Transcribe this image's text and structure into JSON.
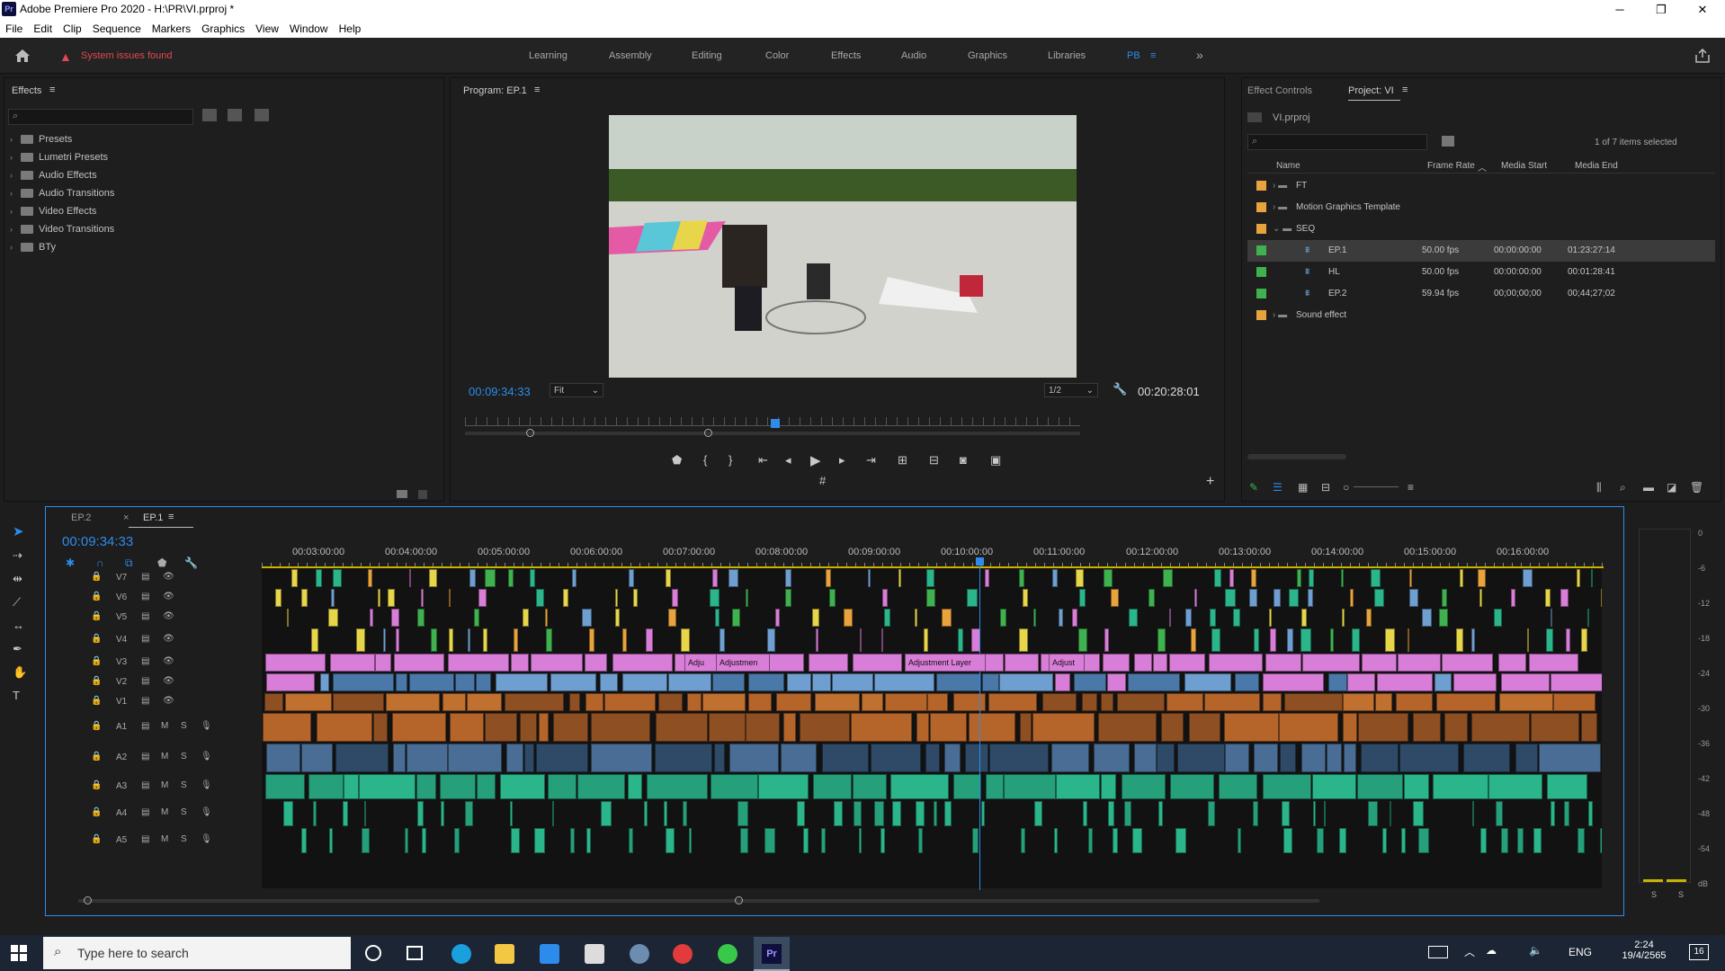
{
  "window": {
    "title": "Adobe Premiere Pro 2020 - H:\\PR\\VI.prproj *",
    "logo": "Pr",
    "minimize": "─",
    "maximize": "❐",
    "close": "✕"
  },
  "menu": [
    "File",
    "Edit",
    "Clip",
    "Sequence",
    "Markers",
    "Graphics",
    "View",
    "Window",
    "Help"
  ],
  "workspace": {
    "warning": "System issues found",
    "tabs": [
      "Learning",
      "Assembly",
      "Editing",
      "Color",
      "Effects",
      "Audio",
      "Graphics",
      "Libraries",
      "PB"
    ],
    "active": "PB",
    "more": "»"
  },
  "effects_panel": {
    "title": "Effects",
    "menu": "≡",
    "items": [
      "Presets",
      "Lumetri Presets",
      "Audio Effects",
      "Audio Transitions",
      "Video Effects",
      "Video Transitions",
      "BTy"
    ]
  },
  "program_monitor": {
    "title": "Program: EP.1",
    "timecode": "00:09:34:33",
    "fit": "Fit",
    "resolution": "1/2",
    "duration": "00:20:28:01",
    "add": "+"
  },
  "project_panel": {
    "tab_effect_controls": "Effect Controls",
    "tab_project": "Project: VI",
    "file": "VI.prproj",
    "count": "1 of 7 items selected",
    "columns": [
      "Name",
      "Frame Rate",
      "Media Start",
      "Media End"
    ],
    "rows": [
      {
        "name": "FT",
        "fps": "",
        "start": "",
        "end": "",
        "color": "#e8a33c",
        "type": "folder"
      },
      {
        "name": "Motion Graphics Template",
        "fps": "",
        "start": "",
        "end": "",
        "color": "#e8a33c",
        "type": "folder"
      },
      {
        "name": "SEQ",
        "fps": "",
        "start": "",
        "end": "",
        "color": "#e8a33c",
        "type": "folder-open"
      },
      {
        "name": "EP.1",
        "fps": "50.00 fps",
        "start": "00:00:00:00",
        "end": "01:23:27:14",
        "color": "#3fb24f",
        "type": "seq",
        "selected": true
      },
      {
        "name": "HL",
        "fps": "50.00 fps",
        "start": "00:00:00:00",
        "end": "00:01:28:41",
        "color": "#3fb24f",
        "type": "seq"
      },
      {
        "name": "EP.2",
        "fps": "59.94 fps",
        "start": "00;00;00;00",
        "end": "00;44;27;02",
        "color": "#3fb24f",
        "type": "seq"
      },
      {
        "name": "Sound effect",
        "fps": "",
        "start": "",
        "end": "",
        "color": "#e8a33c",
        "type": "folder"
      }
    ]
  },
  "timeline": {
    "tabs": [
      "EP.2",
      "EP.1"
    ],
    "active_tab": "EP.1",
    "timecode": "00:09:34:33",
    "ruler": [
      "00:03:00:00",
      "00:04:00:00",
      "00:05:00:00",
      "00:06:00:00",
      "00:07:00:00",
      "00:08:00:00",
      "00:09:00:00",
      "00:10:00:00",
      "00:11:00:00",
      "00:12:00:00",
      "00:13:00:00",
      "00:14:00:00",
      "00:15:00:00",
      "00:16:00:00"
    ],
    "video_tracks": [
      "V7",
      "V6",
      "V5",
      "V4",
      "V3",
      "V2",
      "V1"
    ],
    "audio_tracks": [
      "A1",
      "A2",
      "A3",
      "A4",
      "A5"
    ],
    "clip_labels": [
      "Adju",
      "Adjustmen",
      "Adjustment Layer",
      "Adjust"
    ],
    "m": "M",
    "s": "S"
  },
  "meter": {
    "scale": [
      "0",
      "-6",
      "-12",
      "-18",
      "-24",
      "-30",
      "-36",
      "-42",
      "-48",
      "-54",
      "dB"
    ],
    "s1": "S",
    "s2": "S"
  },
  "taskbar": {
    "search": "Type here to search",
    "lang": "ENG",
    "time": "2:24",
    "date": "19/4/2565",
    "notif": "16"
  }
}
